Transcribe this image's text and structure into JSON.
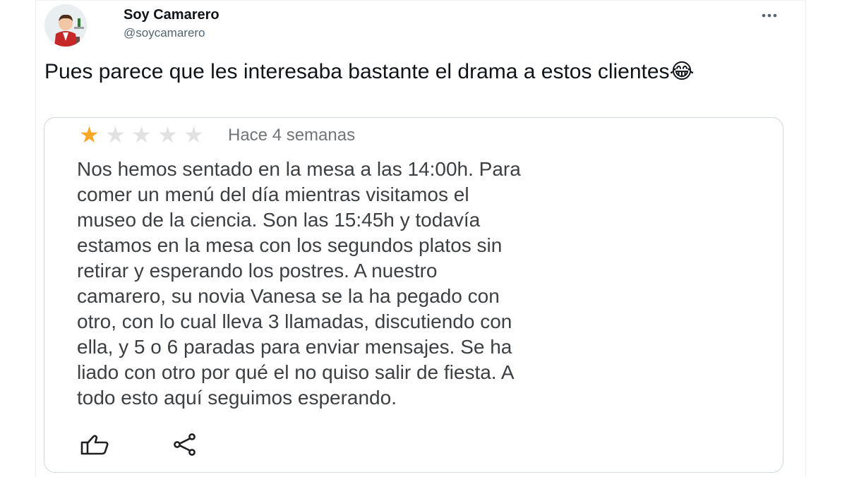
{
  "tweet": {
    "author": {
      "display_name": "Soy Camarero",
      "handle": "@soycamarero",
      "avatar_icon": "waiter-avatar-icon"
    },
    "more_icon": "more-dots-icon",
    "text": "Pues parece que les interesaba bastante el drama a estos clientes😂"
  },
  "review": {
    "rating": 1,
    "rating_max": 5,
    "date": "Hace 4 semanas",
    "body_lines": [
      "Nos hemos sentado en la mesa a las 14:00h. Para",
      "comer un menú del día mientras visitamos el",
      "museo de la ciencia. Son las 15:45h y todavía",
      "estamos en la mesa con los segundos platos sin",
      "retirar y esperando los postres. A nuestro",
      "camarero, su novia Vanesa se la ha pegado con",
      "otro, con lo cual lleva 3 llamadas, discutiendo con",
      "ella, y 5 o 6 paradas para enviar mensajes. Se ha",
      "liado con otro por qué el no quiso salir de fiesta. A",
      "todo esto aquí seguimos esperando."
    ],
    "actions": {
      "like_icon": "thumbs-up-icon",
      "share_icon": "share-icon"
    },
    "colors": {
      "star_filled": "#f9a825",
      "star_empty": "#e2e2e2"
    }
  }
}
